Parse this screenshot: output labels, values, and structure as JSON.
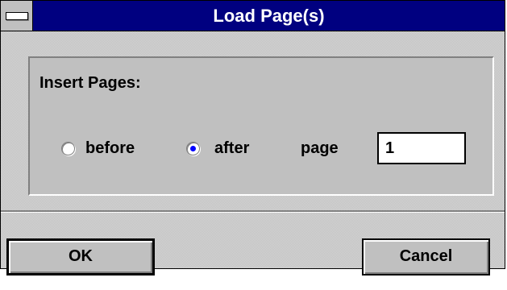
{
  "window": {
    "title": "Load Page(s)"
  },
  "insert_group": {
    "heading": "Insert Pages:",
    "options": [
      {
        "label": "before",
        "selected": false
      },
      {
        "label": "after",
        "selected": true
      }
    ],
    "page_label": "page",
    "page_value": "1"
  },
  "buttons": {
    "ok_label": "OK",
    "cancel_label": "Cancel"
  },
  "colors": {
    "titlebar": "#000080",
    "face": "#c0c0c0",
    "radio_dot": "#0000ff"
  }
}
